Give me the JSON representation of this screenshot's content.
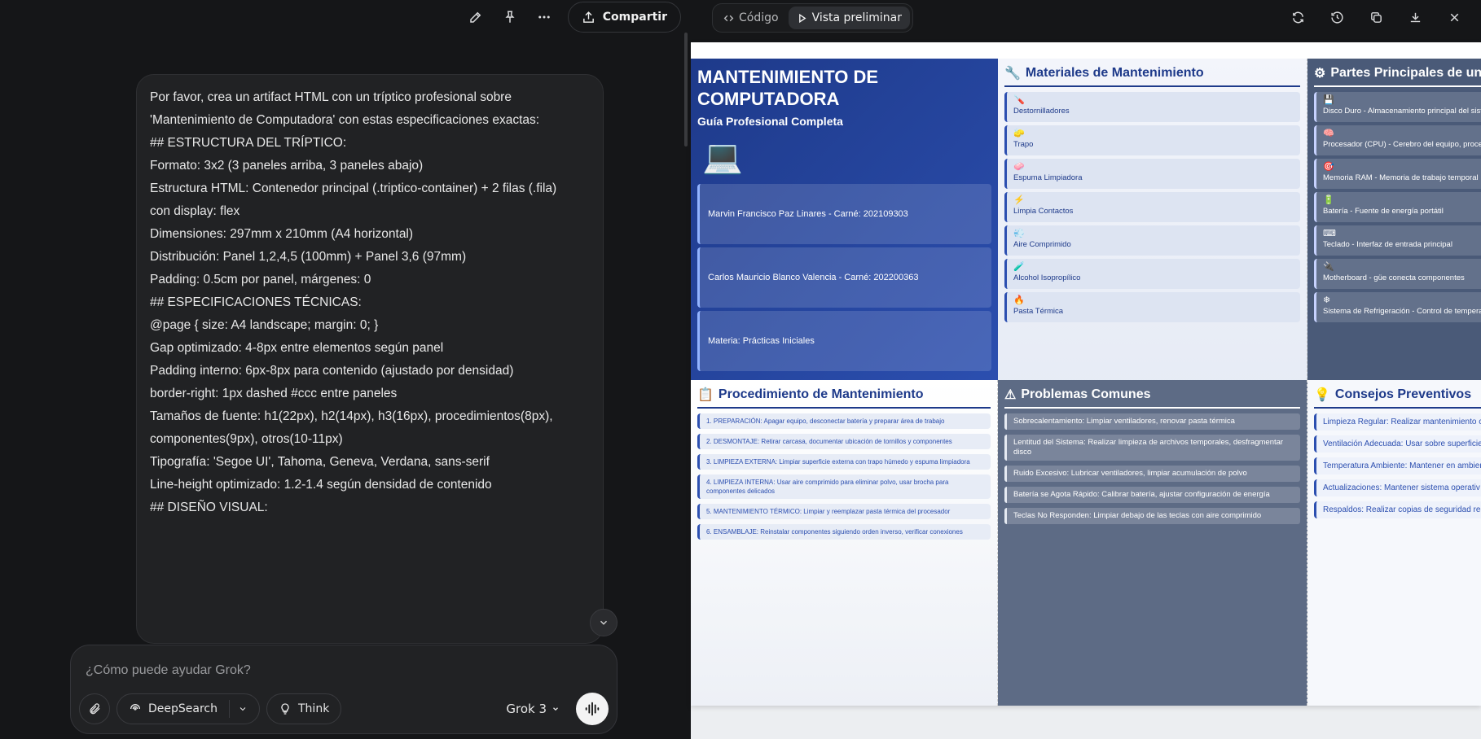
{
  "chat": {
    "toolbar": {
      "share_label": "Compartir"
    },
    "message_lines": [
      "Por favor, crea un artifact HTML con un tríptico profesional sobre",
      "'Mantenimiento de Computadora' con estas especificaciones exactas:",
      "",
      "## ESTRUCTURA DEL TRÍPTICO:",
      "",
      "Formato: 3x2 (3 paneles arriba, 3 paneles abajo)",
      "Estructura HTML: Contenedor principal (.triptico-container) + 2 filas (.fila)",
      "con display: flex",
      "Dimensiones: 297mm x 210mm (A4 horizontal)",
      "Distribución: Panel 1,2,4,5 (100mm) + Panel 3,6 (97mm)",
      "Padding: 0.5cm por panel, márgenes: 0",
      "",
      "## ESPECIFICACIONES TÉCNICAS:",
      "",
      "@page { size: A4 landscape; margin: 0; }",
      "Gap optimizado: 4-8px entre elementos según panel",
      "Padding interno: 6px-8px para contenido (ajustado por densidad)",
      "border-right: 1px dashed #ccc entre paneles",
      "Tamaños de fuente: h1(22px), h2(14px), h3(16px), procedimientos(8px),",
      "componentes(9px), otros(10-11px)",
      "Tipografía: 'Segoe UI', Tahoma, Geneva, Verdana, sans-serif",
      "Line-height optimizado: 1.2-1.4 según densidad de contenido",
      "",
      "## DISEÑO VISUAL:"
    ],
    "composer": {
      "placeholder": "¿Cómo puede ayudar Grok?",
      "deepsearch_label": "DeepSearch",
      "think_label": "Think",
      "model_label": "Grok 3"
    }
  },
  "preview": {
    "tabs": {
      "code_label": "Código",
      "preview_label": "Vista preliminar"
    },
    "brochure": {
      "title": "MANTENIMIENTO DE COMPUTADORA",
      "subtitle": "Guía Profesional Completa",
      "cover_icon": "💻",
      "info_cards": [
        "Marvin Francisco Paz Linares - Carné: 202109303",
        "Carlos Mauricio Blanco Valencia - Carné: 202200363",
        "Materia: Prácticas Iniciales"
      ],
      "materials": {
        "icon": "🔧",
        "heading": "Materiales de Mantenimiento",
        "items": [
          {
            "icon": "🪛",
            "label": "Destornilladores"
          },
          {
            "icon": "🧽",
            "label": "Trapo"
          },
          {
            "icon": "🧼",
            "label": "Espuma Limpiadora"
          },
          {
            "icon": "⚡",
            "label": "Limpia Contactos"
          },
          {
            "icon": "💨",
            "label": "Aire Comprimido"
          },
          {
            "icon": "🧪",
            "label": "Alcohol Isopropílico"
          },
          {
            "icon": "🔥",
            "label": "Pasta Térmica"
          }
        ]
      },
      "parts": {
        "icon": "⚙",
        "heading": "Partes Principales de una",
        "items": [
          {
            "icon": "💾",
            "label": "Disco Duro - Almacenamiento principal del sisten"
          },
          {
            "icon": "🧠",
            "label": "Procesador (CPU) - Cerebro del equipo, procesa c"
          },
          {
            "icon": "🎯",
            "label": "Memoria RAM - Memoria de trabajo temporal"
          },
          {
            "icon": "🔋",
            "label": "Batería - Fuente de energía portátil"
          },
          {
            "icon": "⌨",
            "label": "Teclado - Interfaz de entrada principal"
          },
          {
            "icon": "🔌",
            "label": "Motherboard - güe conecta componentes"
          },
          {
            "icon": "❄",
            "label": "Sistema de Refrigeración - Control de temperatur"
          }
        ]
      },
      "procedure": {
        "icon": "📋",
        "heading": "Procedimiento de Mantenimiento",
        "steps": [
          "1. PREPARACIÓN: Apagar equipo, desconectar batería y preparar área de trabajo",
          "2. DESMONTAJE: Retirar carcasa, documentar ubicación de tornillos y componentes",
          "3. LIMPIEZA EXTERNA: Limpiar superficie externa con trapo húmedo y espuma limpiadora",
          "4. LIMPIEZA INTERNA: Usar aire comprimido para eliminar polvo, usar brocha para componentes delicados",
          "5. MANTENIMIENTO TÉRMICO: Limpiar y reemplazar pasta térmica del procesador",
          "6. ENSAMBLAJE: Reinstalar componentes siguiendo orden inverso, verificar conexiones"
        ]
      },
      "problems": {
        "icon": "⚠",
        "heading": "Problemas Comunes",
        "items": [
          "Sobrecalentamiento: Limpiar ventiladores, renovar pasta térmica",
          "Lentitud del Sistema: Realizar limpieza de archivos temporales, desfragmentar disco",
          "Ruido Excesivo: Lubricar ventiladores, limpiar acumulación de polvo",
          "Batería se Agota Rápido: Calibrar batería, ajustar configuración de energía",
          "Teclas No Responden: Limpiar debajo de las teclas con aire comprimido"
        ]
      },
      "tips": {
        "icon": "💡",
        "heading": "Consejos Preventivos",
        "items": [
          "Limpieza Regular: Realizar mantenimiento ca",
          "Ventilación Adecuada: Usar sobre superficie",
          "Temperatura Ambiente: Mantener en ambien al sol",
          "Actualizaciones: Mantener sistema operativ",
          "Respaldos: Realizar copias de seguridad regu actualizado"
        ]
      }
    }
  }
}
